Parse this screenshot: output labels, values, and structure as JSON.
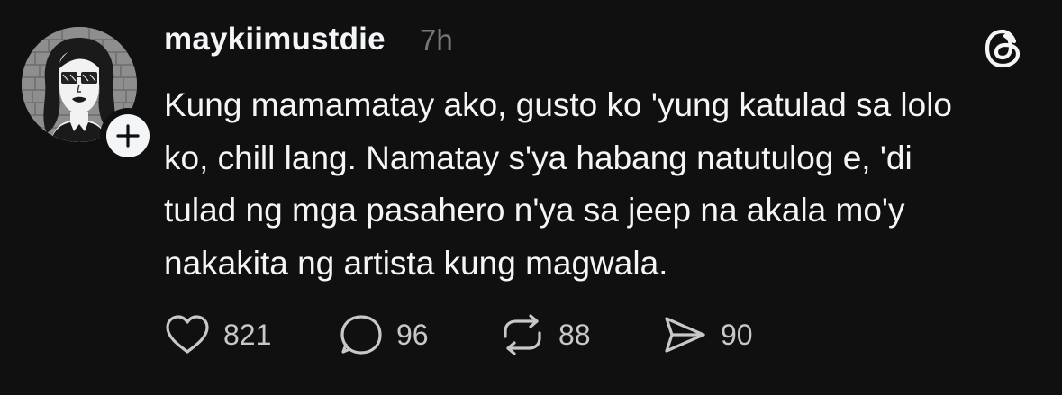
{
  "post": {
    "username": "maykiimustdie",
    "time": "7h",
    "text_lines": [
      "Kung mamamatay ako, gusto ko 'yung katulad sa lolo",
      "ko, chill lang. Namatay s'ya habang natutulog e, 'di",
      "tulad ng mga pasahero n'ya sa jeep na akala mo'y",
      "nakakita ng artista kung magwala."
    ]
  },
  "actions": {
    "likes": "821",
    "replies": "96",
    "reposts": "88",
    "shares": "90"
  },
  "icons": {
    "avatar": "avatar-cartoon-woman-glasses",
    "follow": "plus-icon",
    "brand": "threads-logo-icon",
    "like": "heart-icon",
    "reply": "speech-bubble-icon",
    "repost": "repost-icon",
    "share": "send-icon"
  },
  "colors": {
    "background": "#101010",
    "text": "#f3f5f7",
    "muted": "#777777",
    "counts": "#c8c8c8"
  }
}
